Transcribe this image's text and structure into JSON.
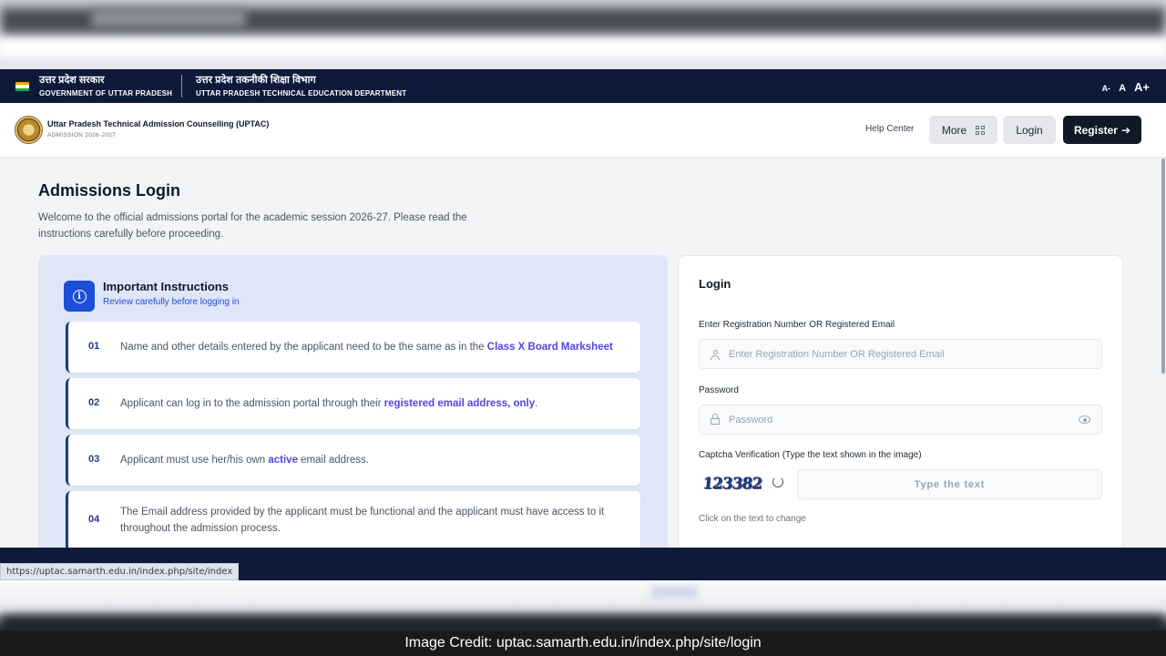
{
  "gov": {
    "state_hi": "उत्तर प्रदेश सरकार",
    "state_en": "GOVERNMENT OF UTTAR PRADESH",
    "dept_hi": "उत्तर प्रदेश तकनीकी शिक्षा विभाग",
    "dept_en": "UTTAR PRADESH TECHNICAL EDUCATION DEPARTMENT",
    "font_small": "A-",
    "font_normal": "A",
    "font_large": "A+"
  },
  "header": {
    "title": "Uttar Pradesh Technical Admission Counselling (UPTAC)",
    "subtitle": "ADMISSION 2026-2027",
    "help": "Help Center",
    "more": "More",
    "login": "Login",
    "register": "Register",
    "register_arrow": "➔"
  },
  "page": {
    "title": "Admissions Login",
    "description": "Welcome to the official admissions portal for the academic session 2026-27. Please read the instructions carefully before proceeding."
  },
  "instructions": {
    "heading": "Important Instructions",
    "subheading": "Review carefully before logging in",
    "items": [
      {
        "num": "01",
        "pre": "Name and other details entered by the applicant need to be the same as in the ",
        "bold": "Class X Board Marksheet",
        "post": ""
      },
      {
        "num": "02",
        "pre": "Applicant can log in to the admission portal through their ",
        "bold": "registered email address, only",
        "post": "."
      },
      {
        "num": "03",
        "pre": "Applicant must use her/his own ",
        "bold": "active",
        "post": " email address."
      },
      {
        "num": "04",
        "pre": "The Email address provided by the applicant must be functional and the applicant must have access to it throughout the admission process.",
        "bold": "",
        "post": ""
      }
    ]
  },
  "login": {
    "title": "Login",
    "reg_label": "Enter Registration Number OR Registered Email",
    "reg_placeholder": "Enter Registration Number OR Registered Email",
    "password_label": "Password",
    "password_placeholder": "Password",
    "captcha_label": "Captcha Verification (Type the text shown in the image)",
    "captcha_text": "123382",
    "captcha_placeholder": "Type the text",
    "captcha_hint": "Click on the text to change"
  },
  "status_url": "https://uptac.samarth.edu.in/index.php/site/index",
  "credit": "Image Credit: uptac.samarth.edu.in/index.php/site/login"
}
